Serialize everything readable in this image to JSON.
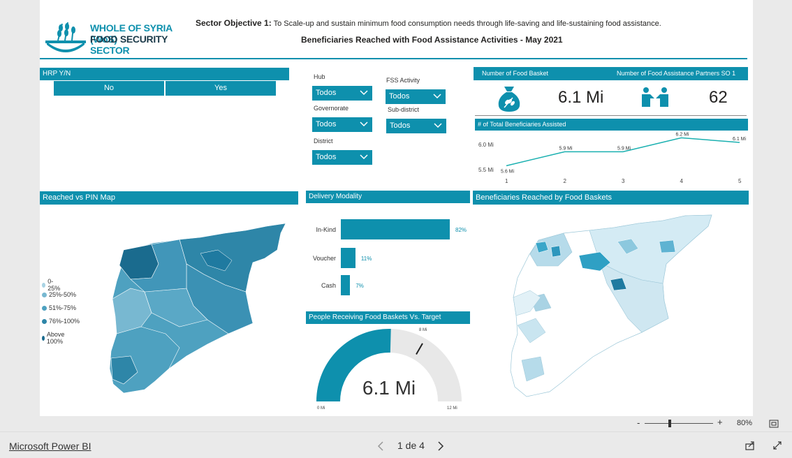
{
  "header": {
    "logo_line1": "WHOLE OF SYRIA (WoS)",
    "logo_line2": "FOOD SECURITY",
    "logo_line3": "SECTOR",
    "objective_label": "Sector Objective 1:",
    "objective_text": "To Scale-up and sustain minimum food consumption needs through life-saving and life-sustaining food assistance.",
    "subtitle": "Beneficiaries Reached with Food Assistance Activities - May 2021"
  },
  "hrp": {
    "title": "HRP Y/N",
    "options": [
      "No",
      "Yes"
    ]
  },
  "filters": {
    "hub_label": "Hub",
    "hub_value": "Todos",
    "governorate_label": "Governorate",
    "governorate_value": "Todos",
    "district_label": "District",
    "district_value": "Todos",
    "activity_label": "FSS Activity",
    "activity_value": "Todos",
    "subdistrict_label": "Sub-district",
    "subdistrict_value": "Todos"
  },
  "kpi": {
    "basket_title": "Number of Food Basket",
    "basket_value": "6.1 Mi",
    "partners_title": "Number of Food Assistance Partners SO 1",
    "partners_value": "62",
    "basket_icon": "food-bag-icon",
    "partners_icon": "handshake-icon"
  },
  "trend": {
    "title": "# of Total Beneficiaries Assisted",
    "y_ticks": [
      "6.0 Mi",
      "5.5 Mi"
    ],
    "x_ticks": [
      "1",
      "2",
      "3",
      "4",
      "5"
    ],
    "point_labels": [
      "5.6 Mi",
      "5.9 Mi",
      "5.9 Mi",
      "6.2 Mi",
      "6.1 Mi"
    ]
  },
  "chart_data": {
    "type": "line",
    "x": [
      1,
      2,
      3,
      4,
      5
    ],
    "values": [
      5.6,
      5.9,
      5.9,
      6.2,
      6.1
    ],
    "title": "# of Total Beneficiaries Assisted",
    "ylim": [
      5.5,
      6.25
    ]
  },
  "map_left": {
    "title": "Reached vs PIN Map",
    "legend": [
      {
        "label": "0-25%",
        "color": "#a9d3e4"
      },
      {
        "label": "25%-50%",
        "color": "#78b8d1"
      },
      {
        "label": "51%-75%",
        "color": "#4ea1c0"
      },
      {
        "label": "76%-100%",
        "color": "#2e86a8"
      },
      {
        "label": "Above 100%",
        "color": "#1a6b8e"
      }
    ]
  },
  "delivery": {
    "title": "Delivery Modality",
    "items": [
      {
        "label": "In-Kind",
        "value": 82,
        "text": "82%"
      },
      {
        "label": "Voucher",
        "value": 11,
        "text": "11%"
      },
      {
        "label": "Cash",
        "value": 7,
        "text": "7%"
      }
    ]
  },
  "gauge": {
    "title": "People Receiving Food Baskets Vs. Target",
    "value_text": "6.1 Mi",
    "min_text": "0 Mi",
    "max_text": "12 Mi",
    "target_text": "8 Mi",
    "value": 6.1,
    "min": 0,
    "max": 12,
    "target": 8
  },
  "map_right": {
    "title": "Beneficiaries Reached by Food Baskets"
  },
  "zoom": {
    "minus": "-",
    "plus": "+",
    "percent": "80%"
  },
  "footer": {
    "brand": "Microsoft Power BI",
    "page": "1 de 4"
  }
}
